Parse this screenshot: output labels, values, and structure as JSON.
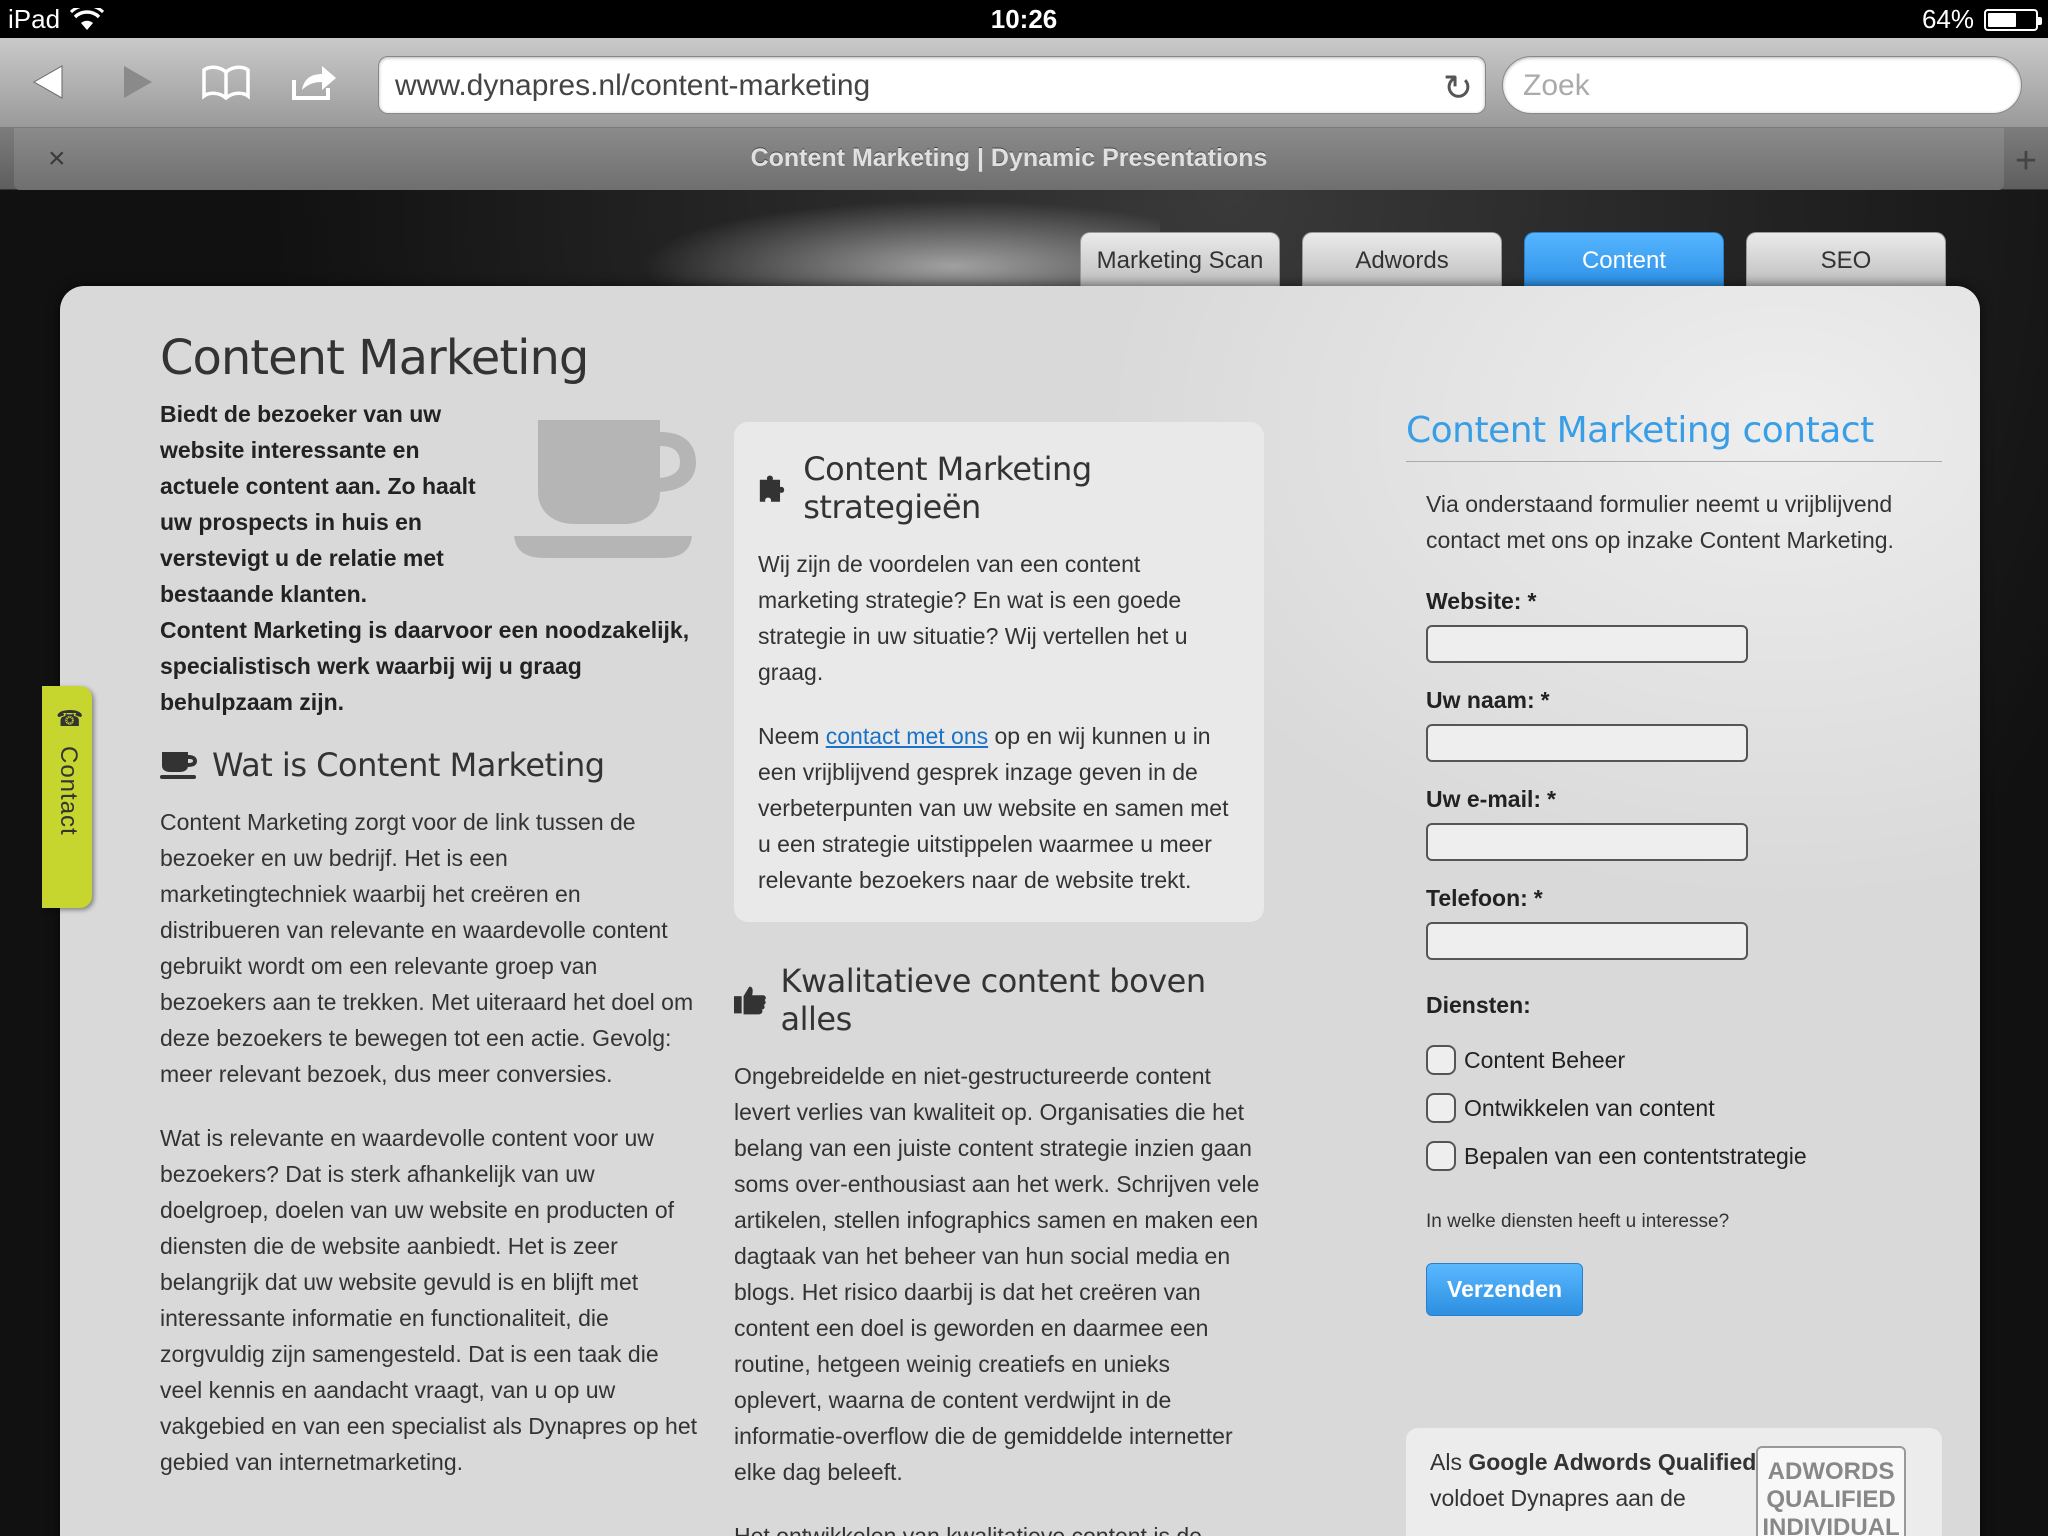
{
  "status": {
    "device": "iPad",
    "time": "10:26",
    "battery": "64%",
    "battery_level": 0.64
  },
  "browser": {
    "url": "www.dynapres.nl/content-marketing",
    "search_placeholder": "Zoek",
    "tab_title": "Content Marketing | Dynamic Presentations",
    "tab_close": "×",
    "tab_new": "+"
  },
  "site_nav": [
    "Marketing Scan",
    "Adwords",
    "Content",
    "SEO"
  ],
  "contact_tab": "Contact",
  "left": {
    "title": "Content Marketing",
    "intro_narrow": "Biedt de bezoeker van uw website interessante en actuele content aan. Zo haalt uw prospects in huis en verstevigt u de relatie met bestaande klanten.",
    "intro_wide": "Content Marketing is daarvoor een noodzakelijk, specialistisch werk waarbij wij u graag behulpzaam zijn.",
    "heading": "Wat is Content Marketing",
    "para1": "Content Marketing zorgt voor de link tussen de bezoeker en uw bedrijf. Het is een marketingtechniek waarbij het creëren en distribueren van relevante en waardevolle content gebruikt wordt om een relevante groep van bezoekers aan te trekken. Met uiteraard het doel om deze bezoekers te bewegen tot een actie. Gevolg: meer relevant bezoek, dus meer conversies.",
    "para2": "Wat is relevante en waardevolle content voor uw bezoekers? Dat is sterk afhankelijk van uw doelgroep, doelen van uw website en producten of diensten die de website aanbiedt. Het is zeer belangrijk dat uw website gevuld is en blijft met interessante informatie en functionaliteit, die zorgvuldig zijn samengesteld. Dat is een taak die veel kennis en aandacht vraagt, van u op uw vakgebied en van een specialist als Dynapres op het gebied van internetmarketing."
  },
  "middle": {
    "box_heading": "Content Marketing strategieën",
    "box_para1": "Wij zijn de voordelen van een content marketing strategie? En wat is een goede strategie in uw situatie? Wij vertellen het u graag.",
    "box_para2_before": "Neem ",
    "box_para2_link": "contact met ons",
    "box_para2_after": " op en wij kunnen u in een vrijblijvend gesprek inzage geven in de verbeterpunten van uw website en samen met u een strategie uitstippelen waarmee u meer relevante bezoekers naar de website trekt.",
    "heading2": "Kwalitatieve content boven alles",
    "para3": "Ongebreidelde en niet-gestructureerde content levert verlies van kwaliteit op. Organisaties die het belang van een juiste content strategie inzien gaan soms over-enthousiast aan het werk. Schrijven vele artikelen, stellen infographics samen en maken een dagtaak van het beheer van hun social media en blogs. Het risico daarbij is dat het creëren van content een doel is geworden en daarmee een routine, hetgeen weinig creatiefs en unieks oplevert, waarna de content verdwijnt in de informatie-overflow die de gemiddelde internetter elke dag beleeft.",
    "para4": "Het ontwikkelen van kwalitatieve content is de"
  },
  "form": {
    "title": "Content Marketing contact",
    "description": "Via onderstaand formulier neemt u vrijblijvend contact met ons op inzake Content Marketing.",
    "fields": [
      {
        "label": "Website:",
        "required": "*"
      },
      {
        "label": "Uw naam:",
        "required": "*"
      },
      {
        "label": "Uw e-mail:",
        "required": "*"
      },
      {
        "label": "Telefoon:",
        "required": "*"
      }
    ],
    "services_label": "Diensten:",
    "services": [
      "Content Beheer",
      "Ontwikkelen van content",
      "Bepalen van een contentstrategie"
    ],
    "hint": "In welke diensten heeft u interesse?",
    "submit": "Verzenden"
  },
  "adwords": {
    "text_before": "Als ",
    "text_bold": "Google Adwords Qualified Professional",
    "text_after": " voldoet Dynapres aan de",
    "badge_line1": "ADWORDS",
    "badge_line2": "QUALIFIED",
    "badge_line3": "INDIVIDUAL"
  },
  "colors": {
    "accent_blue": "#3a9ee6",
    "contact_tab": "#c6d62e",
    "panel": "#d9d9d9"
  }
}
